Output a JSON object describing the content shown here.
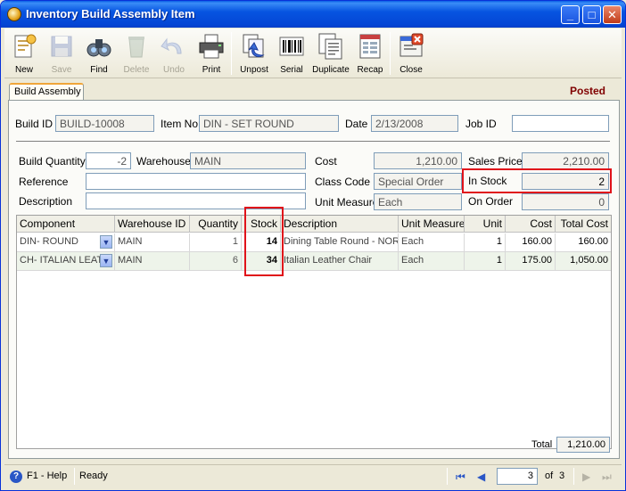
{
  "window": {
    "title": "Inventory Build Assembly Item",
    "controls": {
      "minimize": "_",
      "maximize": "□",
      "close": "✕"
    }
  },
  "toolbar": {
    "items": [
      {
        "label": "New",
        "icon": "new-doc-icon",
        "enabled": true
      },
      {
        "label": "Save",
        "icon": "save-disk-icon",
        "enabled": false
      },
      {
        "label": "Find",
        "icon": "binoculars-icon",
        "enabled": true
      },
      {
        "label": "Delete",
        "icon": "recycle-bin-icon",
        "enabled": false
      },
      {
        "label": "Undo",
        "icon": "undo-arrow-icon",
        "enabled": false
      },
      {
        "label": "Print",
        "icon": "printer-icon",
        "enabled": true
      },
      {
        "label": "Unpost",
        "icon": "unpost-icon",
        "enabled": true
      },
      {
        "label": "Serial",
        "icon": "barcode-icon",
        "enabled": true
      },
      {
        "label": "Duplicate",
        "icon": "duplicate-icon",
        "enabled": true
      },
      {
        "label": "Recap",
        "icon": "recap-icon",
        "enabled": true
      },
      {
        "label": "Close",
        "icon": "close-window-icon",
        "enabled": true
      }
    ]
  },
  "tab": {
    "label": "Build Assembly"
  },
  "status_flag": "Posted",
  "header": {
    "build_id_label": "Build ID",
    "build_id": "BUILD-10008",
    "item_no_label": "Item No",
    "item_no": "DIN - SET ROUND",
    "date_label": "Date",
    "date": "2/13/2008",
    "job_id_label": "Job ID",
    "job_id": ""
  },
  "details": {
    "build_qty_label": "Build Quantity",
    "build_qty": "-2",
    "warehouse_label": "Warehouse",
    "warehouse": "MAIN",
    "cost_label": "Cost",
    "cost": "1,210.00",
    "sales_price_label": "Sales Price",
    "sales_price": "2,210.00",
    "reference_label": "Reference",
    "reference": "",
    "class_code_label": "Class Code",
    "class_code": "Special Order",
    "in_stock_label": "In Stock",
    "in_stock": "2",
    "description_label": "Description",
    "description": "",
    "unit_measure_label": "Unit Measure",
    "unit_measure": "Each",
    "on_order_label": "On Order",
    "on_order": "0"
  },
  "grid": {
    "columns": [
      "Component",
      "Warehouse ID",
      "Quantity",
      "Stock",
      "Description",
      "Unit Measure",
      "Unit",
      "Cost",
      "Total Cost"
    ],
    "rows": [
      {
        "component": "DIN- ROUND",
        "warehouse": "MAIN",
        "quantity": "1",
        "stock": "14",
        "description": "Dining Table Round - NORD",
        "unit_measure": "Each",
        "unit": "1",
        "cost": "160.00",
        "total_cost": "160.00"
      },
      {
        "component": "CH- ITALIAN LEATH",
        "warehouse": "MAIN",
        "quantity": "6",
        "stock": "34",
        "description": "Italian Leather Chair",
        "unit_measure": "Each",
        "unit": "1",
        "cost": "175.00",
        "total_cost": "1,050.00"
      }
    ],
    "total_label": "Total",
    "total": "1,210.00"
  },
  "statusbar": {
    "help": "F1 - Help",
    "status": "Ready",
    "page": "3",
    "of_label": "of",
    "total_pages": "3"
  }
}
